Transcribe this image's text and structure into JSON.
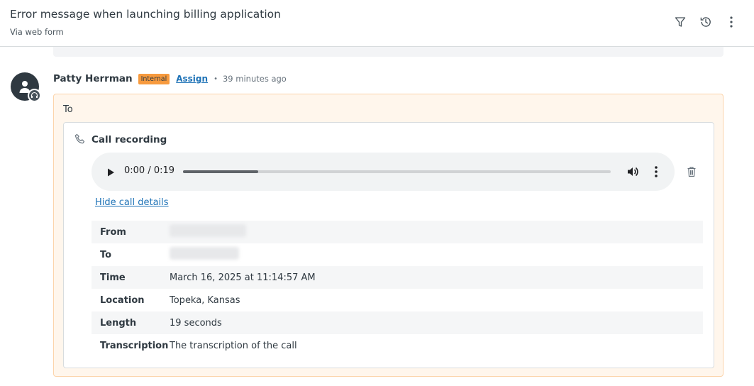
{
  "header": {
    "title": "Error message when launching billing application",
    "subtitle": "Via web form",
    "actions": [
      "filter-icon",
      "history-icon",
      "more-vertical-icon"
    ]
  },
  "comment": {
    "author": "Patty Herrman",
    "badge": "Internal",
    "assign_label": "Assign",
    "separator": "•",
    "time_ago": "39 minutes ago",
    "to_label": "To",
    "badge_color": "#f79a3e",
    "note_background": "#fff6ec",
    "link_color": "#1f73b7"
  },
  "call": {
    "title": "Call recording",
    "player": {
      "time": "0:00 / 0:19",
      "progress": 0.175
    },
    "hide_details_label": "Hide call details",
    "details": [
      {
        "label": "From",
        "value": ""
      },
      {
        "label": "To",
        "value": ""
      },
      {
        "label": "Time",
        "value": "March 16, 2025 at 11:14:57 AM"
      },
      {
        "label": "Location",
        "value": "Topeka, Kansas"
      },
      {
        "label": "Length",
        "value": "19 seconds"
      },
      {
        "label": "Transcription",
        "value": "The transcription of the call"
      }
    ]
  }
}
